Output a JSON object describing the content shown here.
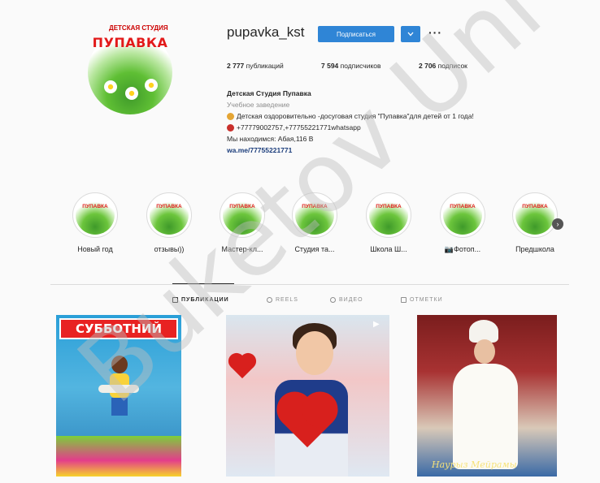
{
  "profile": {
    "avatar_logo": "ПУПАВКА",
    "avatar_top": "ДЕТСКАЯ СТУДИЯ",
    "username": "pupavka_kst",
    "follow_label": "Подписаться",
    "more_label": "···",
    "stats": {
      "posts_count": "2 777",
      "posts_label": "публикаций",
      "followers_count": "7 594",
      "followers_label": "подписчиков",
      "following_count": "2 706",
      "following_label": "подписок"
    },
    "bio": {
      "name": "Детская Студия Пупавка",
      "category": "Учебное заведение",
      "description": "Детская оздоровительно -досуговая студия \"Пупавка\"для детей от 1 года!",
      "phones": "+77779002757,+77755221771whatsapp",
      "address": "Мы находимся: Абая,116 В",
      "link": "wa.me/77755221771"
    }
  },
  "highlights": [
    {
      "label": "Новый год",
      "logo": "ПУПАВКА"
    },
    {
      "label": "отзывы))",
      "logo": "ПУПАВКА"
    },
    {
      "label": "Мастер-кл...",
      "logo": "ПУПАВКА"
    },
    {
      "label": "Студия та...",
      "logo": "ПУПАВКА"
    },
    {
      "label": "Школа Ш...",
      "logo": "ПУПАВКА"
    },
    {
      "label": "📷Фотоп...",
      "logo": "ПУПАВКА"
    },
    {
      "label": "Предшкола",
      "logo": "ПУПАВКА"
    }
  ],
  "tabs": [
    {
      "label": "ПУБЛИКАЦИИ",
      "active": true
    },
    {
      "label": "REELS",
      "active": false
    },
    {
      "label": "ВИДЕО",
      "active": false
    },
    {
      "label": "ОТМЕТКИ",
      "active": false
    }
  ],
  "posts": [
    {
      "banner": "СУББОТНИЙ"
    },
    {
      "banner": ""
    },
    {
      "caption": "Наурыз Мейрамы"
    }
  ],
  "watermark": "Buketov Uni",
  "colors": {
    "follow_button": "#2f85d6",
    "link": "#1a3c7b",
    "logo_red": "#e21a1a"
  }
}
